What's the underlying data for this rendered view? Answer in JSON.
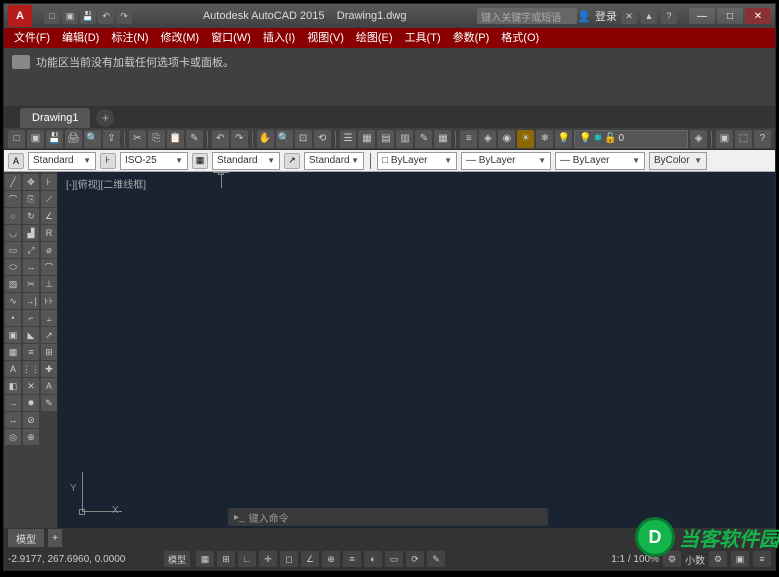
{
  "title": {
    "app": "Autodesk AutoCAD 2015",
    "doc": "Drawing1.dwg"
  },
  "app_logo": "A",
  "search_placeholder": "键入关键字或短语",
  "login_label": "登录",
  "menubar": [
    "文件(F)",
    "编辑(D)",
    "标注(N)",
    "修改(M)",
    "窗口(W)",
    "插入(I)",
    "视图(V)",
    "绘图(E)",
    "工具(T)",
    "参数(P)",
    "格式(O)"
  ],
  "ribbon_message": "功能区当前没有加载任何选项卡或面板。",
  "doc_tabs": {
    "active": "Drawing1"
  },
  "toolbar2": {
    "dd1": "Standard",
    "dd2": "ISO-25",
    "dd3": "Standard",
    "dd4": "Standard",
    "layer_color": "ByLayer",
    "layer_lt": "ByLayer",
    "layer_lw": "ByLayer",
    "plot": "ByColor",
    "zero": "0"
  },
  "viewport_label": "[-][俯视][二维线框]",
  "ucs": {
    "y": "Y",
    "x": "X"
  },
  "layout_tabs": {
    "model": "模型"
  },
  "cmdline_prompt": "键入命令",
  "statusbar": {
    "coords": "-2.9177, 267.6960, 0.0000",
    "model_label": "模型",
    "scale": "1:1 / 100%",
    "decimal": "小数"
  },
  "watermark_text": "当客软件园",
  "watermark_logo": "D"
}
